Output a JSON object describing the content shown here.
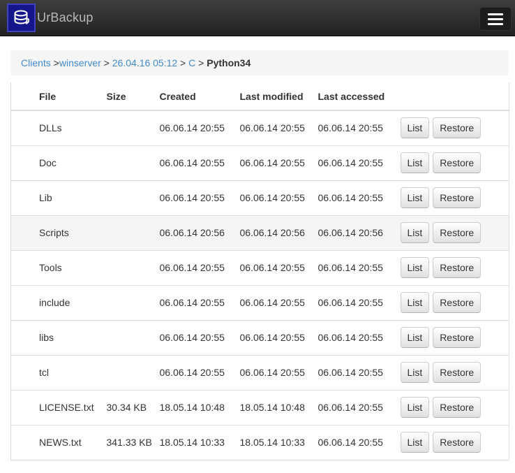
{
  "navbar": {
    "brand": "UrBackup"
  },
  "breadcrumb": {
    "items": [
      {
        "label": "Clients",
        "type": "link",
        "sep_after": " >"
      },
      {
        "label": "winserver",
        "type": "link",
        "sep_after": " > "
      },
      {
        "label": "26.04.16 05:12",
        "type": "link",
        "sep_after": " > "
      },
      {
        "label": "C",
        "type": "link",
        "sep_after": " > "
      },
      {
        "label": "Python34",
        "type": "current",
        "sep_after": ""
      }
    ]
  },
  "table": {
    "headers": {
      "file": "File",
      "size": "Size",
      "created": "Created",
      "modified": "Last modified",
      "accessed": "Last accessed"
    },
    "actions": {
      "list_label": "List",
      "restore_label": "Restore"
    },
    "rows": [
      {
        "file": "DLLs",
        "size": "",
        "created": "06.06.14 20:55",
        "modified": "06.06.14 20:55",
        "accessed": "06.06.14 20:55",
        "highlight": false
      },
      {
        "file": "Doc",
        "size": "",
        "created": "06.06.14 20:55",
        "modified": "06.06.14 20:55",
        "accessed": "06.06.14 20:55",
        "highlight": false
      },
      {
        "file": "Lib",
        "size": "",
        "created": "06.06.14 20:55",
        "modified": "06.06.14 20:55",
        "accessed": "06.06.14 20:55",
        "highlight": false
      },
      {
        "file": "Scripts",
        "size": "",
        "created": "06.06.14 20:56",
        "modified": "06.06.14 20:56",
        "accessed": "06.06.14 20:56",
        "highlight": true
      },
      {
        "file": "Tools",
        "size": "",
        "created": "06.06.14 20:55",
        "modified": "06.06.14 20:55",
        "accessed": "06.06.14 20:55",
        "highlight": false
      },
      {
        "file": "include",
        "size": "",
        "created": "06.06.14 20:55",
        "modified": "06.06.14 20:55",
        "accessed": "06.06.14 20:55",
        "highlight": false
      },
      {
        "file": "libs",
        "size": "",
        "created": "06.06.14 20:55",
        "modified": "06.06.14 20:55",
        "accessed": "06.06.14 20:55",
        "highlight": false
      },
      {
        "file": "tcl",
        "size": "",
        "created": "06.06.14 20:55",
        "modified": "06.06.14 20:55",
        "accessed": "06.06.14 20:55",
        "highlight": false
      },
      {
        "file": "LICENSE.txt",
        "size": "30.34 KB",
        "created": "18.05.14 10:48",
        "modified": "18.05.14 10:48",
        "accessed": "06.06.14 20:55",
        "highlight": false
      },
      {
        "file": "NEWS.txt",
        "size": "341.33 KB",
        "created": "18.05.14 10:33",
        "modified": "18.05.14 10:33",
        "accessed": "06.06.14 20:55",
        "highlight": false
      }
    ]
  },
  "colors": {
    "link": "#428bca",
    "navbar_top": "#3e3e3e",
    "navbar_bottom": "#222222",
    "row_border": "#dddddd",
    "row_highlight": "#f5f5f5",
    "logo_blue": "#16168c"
  }
}
